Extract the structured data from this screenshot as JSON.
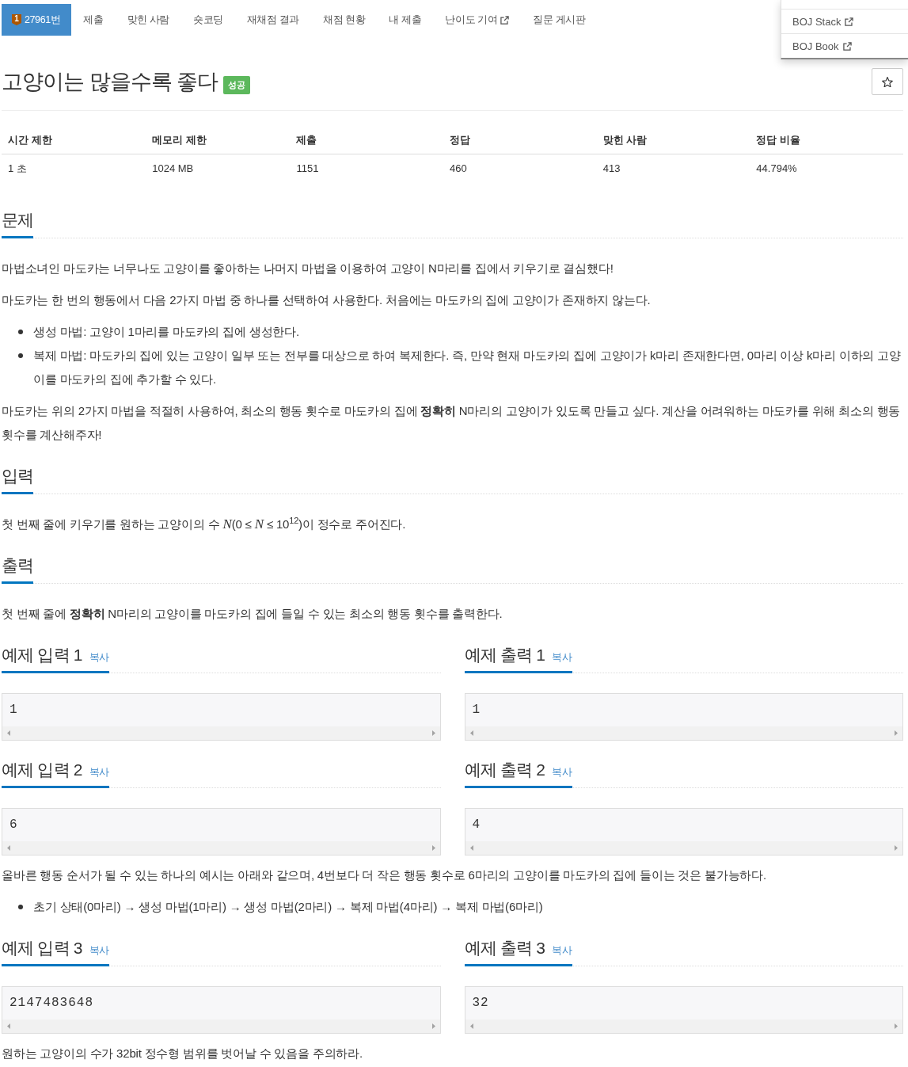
{
  "nav": {
    "tabs": [
      {
        "label": "27961번",
        "selected": true,
        "badge": "1",
        "external": false
      },
      {
        "label": "제출",
        "selected": false,
        "external": false
      },
      {
        "label": "맞힌 사람",
        "selected": false,
        "external": false
      },
      {
        "label": "숏코딩",
        "selected": false,
        "external": false
      },
      {
        "label": "재채점 결과",
        "selected": false,
        "external": false
      },
      {
        "label": "채점 현황",
        "selected": false,
        "external": false
      },
      {
        "label": "내 제출",
        "selected": false,
        "external": false
      },
      {
        "label": "난이도 기여",
        "selected": false,
        "external": true
      },
      {
        "label": "질문 게시판",
        "selected": false,
        "external": false
      }
    ]
  },
  "dropdown": {
    "items": [
      {
        "label": "BOJ Stack",
        "external": true
      },
      {
        "label": "BOJ Book",
        "external": true
      }
    ]
  },
  "problem_title": {
    "title": "고양이는 많을수록 좋다",
    "result_label": "성공"
  },
  "info_table": {
    "columns": [
      "시간 제한",
      "메모리 제한",
      "제출",
      "정답",
      "맞힌 사람",
      "정답 비율"
    ],
    "rows": [
      [
        "1 초",
        "1024 MB",
        "1151",
        "460",
        "413",
        "44.794%"
      ]
    ]
  },
  "sections": [
    {
      "heading": "문제",
      "body": [
        {
          "kind": "paragraph",
          "text": "마법소녀인 마도카는 너무나도 고양이를 좋아하는 나머지 마법을 이용하여 고양이 N마리를 집에서 키우기로 결심했다!"
        },
        {
          "kind": "paragraph",
          "text": "마도카는 한 번의 행동에서 다음 2가지 마법 중 하나를 선택하여 사용한다. 처음에는 마도카의 집에 고양이가 존재하지 않는다."
        },
        {
          "kind": "list",
          "items": [
            "생성 마법: 고양이 1마리를 마도카의 집에 생성한다.",
            "복제 마법: 마도카의 집에 있는 고양이 일부 또는 전부를 대상으로 하여 복제한다. 즉, 만약 현재 마도카의 집에 고양이가 k마리 존재한다면, 0마리 이상 k마리 이하의 고양이를 마도카의 집에 추가할 수 있다."
          ]
        },
        {
          "kind": "paragraph",
          "text": "마도카는 위의 2가지 마법을 적절히 사용하여, 최소의 행동 횟수로 마도카의 집에 **정확히** N마리의 고양이가 있도록 만들고 싶다. 계산을 어려워하는 마도카를 위해 최소의 행동 횟수를 계산해주자!"
        }
      ]
    },
    {
      "heading": "입력",
      "body": [
        {
          "kind": "paragraph",
          "text": "첫 번째 줄에 키우기를 원하는 고양이의 수 *N*(0 ≤ *N* ≤ 10$^{12}$)이 정수로 주어진다."
        }
      ]
    },
    {
      "heading": "출력",
      "body": [
        {
          "kind": "paragraph",
          "text": "첫 번째 줄에 **정확히** N마리의 고양이를 마도카의 집에 들일 수 있는 최소의 행동 횟수를 출력한다."
        }
      ]
    }
  ],
  "samples": [
    {
      "input": {
        "title": "예제 입력 1",
        "copy": "복사",
        "value": "1"
      },
      "output": {
        "title": "예제 출력 1",
        "copy": "복사",
        "value": "1"
      }
    },
    {
      "input": {
        "title": "예제 입력 2",
        "copy": "복사",
        "value": "6"
      },
      "output": {
        "title": "예제 출력 2",
        "copy": "복사",
        "value": "4"
      },
      "explanation": [
        {
          "kind": "paragraph",
          "text": "올바른 행동 순서가 될 수 있는 하나의 예시는 아래와 같으며, 4번보다 더 작은 행동 횟수로 6마리의 고양이를 마도카의 집에 들이는 것은 불가능하다."
        },
        {
          "kind": "list",
          "items": [
            "초기 상태(0마리) → 생성 마법(1마리) → 생성 마법(2마리) → 복제 마법(4마리) → 복제 마법(6마리)"
          ]
        }
      ]
    },
    {
      "input": {
        "title": "예제 입력 3",
        "copy": "복사",
        "value": "2147483648"
      },
      "output": {
        "title": "예제 출력 3",
        "copy": "복사",
        "value": "32"
      },
      "explanation": [
        {
          "kind": "paragraph",
          "text": "원하는 고양이의 수가 32bit 정수형 범위를 벗어날 수 있음을 주의하라."
        }
      ]
    }
  ]
}
